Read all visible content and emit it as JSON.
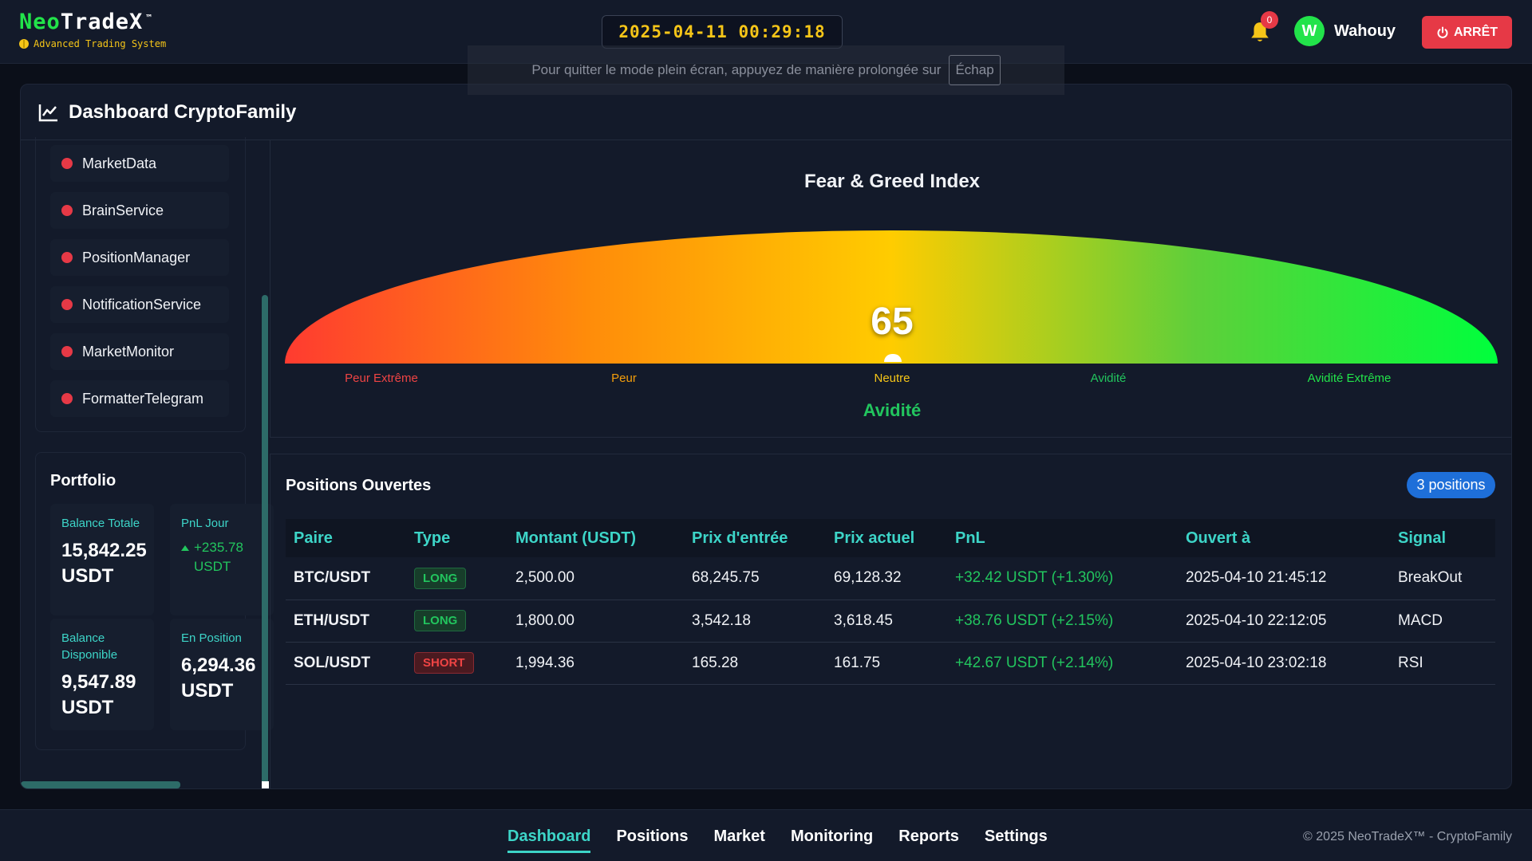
{
  "header": {
    "brand_neo": "Neo",
    "brand_trade": "TradeX",
    "brand_tm": "™",
    "tagline": "Advanced Trading System",
    "clock": "2025-04-11 00:29:18",
    "notification_count": "0",
    "user_initial": "W",
    "user_name": "Wahouy",
    "stop_label": "ARRÊT"
  },
  "fullscreen_toast": {
    "message": "Pour quitter le mode plein écran, appuyez de manière prolongée sur",
    "key": "Échap"
  },
  "dashboard": {
    "title": "Dashboard CryptoFamily"
  },
  "services": [
    {
      "label": "MarketData",
      "status": "offline"
    },
    {
      "label": "BrainService",
      "status": "offline"
    },
    {
      "label": "PositionManager",
      "status": "offline"
    },
    {
      "label": "NotificationService",
      "status": "offline"
    },
    {
      "label": "MarketMonitor",
      "status": "offline"
    },
    {
      "label": "FormatterTelegram",
      "status": "offline"
    }
  ],
  "portfolio": {
    "title": "Portfolio",
    "balance_total_label": "Balance Totale",
    "balance_total_value": "15,842.25 USDT",
    "pnl_day_label": "PnL Jour",
    "pnl_day_value": "+235.78 USDT",
    "balance_available_label": "Balance Disponible",
    "balance_available_value": "9,547.89 USDT",
    "in_position_label": "En Position",
    "in_position_value": "6,294.36 USDT"
  },
  "fear_greed": {
    "title": "Fear & Greed Index",
    "value": 65,
    "value_text": "65",
    "zones": [
      "Peur Extrême",
      "Peur",
      "Neutre",
      "Avidité",
      "Avidité Extrême"
    ],
    "zone_colors": [
      "#ef4444",
      "#f59e0b",
      "#f5c518",
      "#22c55e",
      "#22e34a"
    ],
    "status": "Avidité"
  },
  "positions": {
    "title": "Positions Ouvertes",
    "badge": "3 positions",
    "columns": [
      "Paire",
      "Type",
      "Montant (USDT)",
      "Prix d'entrée",
      "Prix actuel",
      "PnL",
      "Ouvert à",
      "Signal"
    ],
    "rows": [
      {
        "pair": "BTC/USDT",
        "type": "LONG",
        "amount": "2,500.00",
        "entry": "68,245.75",
        "current": "69,128.32",
        "pnl": "+32.42 USDT (+1.30%)",
        "opened": "2025-04-10 21:45:12",
        "signal": "BreakOut"
      },
      {
        "pair": "ETH/USDT",
        "type": "LONG",
        "amount": "1,800.00",
        "entry": "3,542.18",
        "current": "3,618.45",
        "pnl": "+38.76 USDT (+2.15%)",
        "opened": "2025-04-10 22:12:05",
        "signal": "MACD"
      },
      {
        "pair": "SOL/USDT",
        "type": "SHORT",
        "amount": "1,994.36",
        "entry": "165.28",
        "current": "161.75",
        "pnl": "+42.67 USDT (+2.14%)",
        "opened": "2025-04-10 23:02:18",
        "signal": "RSI"
      }
    ]
  },
  "footer": {
    "nav": [
      "Dashboard",
      "Positions",
      "Market",
      "Monitoring",
      "Reports",
      "Settings"
    ],
    "active_nav": "Dashboard",
    "copyright": "© 2025 NeoTradeX™ - CryptoFamily"
  },
  "colors": {
    "accent": "#3dd5c8",
    "brand_green": "#22e34a",
    "danger": "#e63946",
    "clock_yellow": "#f5c518"
  }
}
